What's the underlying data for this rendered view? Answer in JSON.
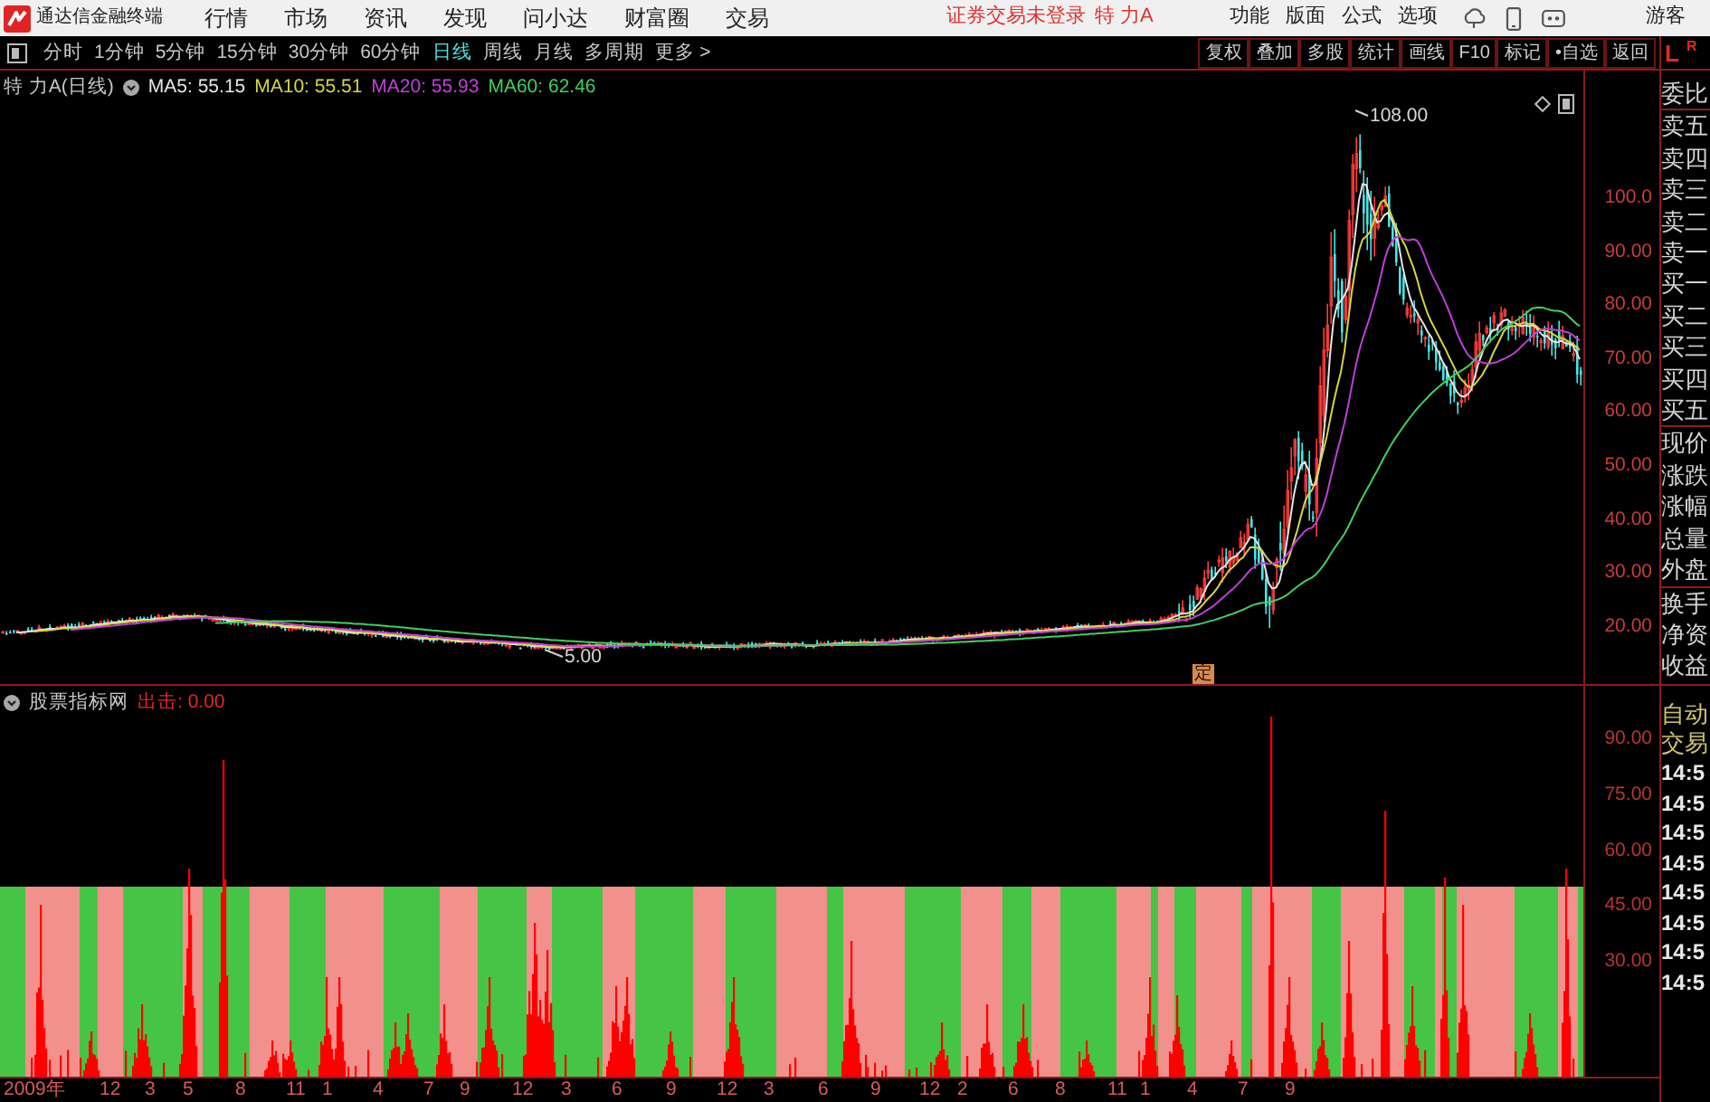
{
  "title_bar": {
    "app_name": "通达信金融终端",
    "menu": [
      "行情",
      "市场",
      "资讯",
      "发现",
      "问小达",
      "财富圈",
      "交易"
    ],
    "login_status": "证券交易未登录",
    "stock_name": "特 力A",
    "tools": [
      "功能",
      "版面",
      "公式",
      "选项"
    ],
    "user": "游客"
  },
  "toolbar": {
    "periods": [
      {
        "label": "分时",
        "selected": false
      },
      {
        "label": "1分钟",
        "selected": false
      },
      {
        "label": "5分钟",
        "selected": false
      },
      {
        "label": "15分钟",
        "selected": false
      },
      {
        "label": "30分钟",
        "selected": false
      },
      {
        "label": "60分钟",
        "selected": false
      },
      {
        "label": "日线",
        "selected": true
      },
      {
        "label": "周线",
        "selected": false
      },
      {
        "label": "月线",
        "selected": false
      },
      {
        "label": "多周期",
        "selected": false
      }
    ],
    "more": "更多 >",
    "actions": [
      "复权",
      "叠加",
      "多股",
      "统计",
      "画线",
      "F10",
      "标记",
      "•自选",
      "返回"
    ]
  },
  "side_header": {
    "left": "L",
    "right": "R"
  },
  "chart": {
    "title": "特 力A(日线)",
    "moving_averages": [
      {
        "label": "MA5: 55.15",
        "color": "#e6e6e6"
      },
      {
        "label": "MA10: 55.51",
        "color": "#d6d640"
      },
      {
        "label": "MA20: 55.93",
        "color": "#c040d8"
      },
      {
        "label": "MA60: 62.46",
        "color": "#40d060"
      }
    ],
    "high_label": "108.00",
    "low_label": "5.00",
    "signal_badge": "定",
    "price_axis": [
      "100.0",
      "90.00",
      "80.00",
      "70.00",
      "60.00",
      "50.00",
      "40.00",
      "30.00",
      "20.00"
    ]
  },
  "quote_panel": {
    "groups": [
      [
        "委比"
      ],
      [
        "卖五",
        "卖四",
        "卖三",
        "卖二",
        "卖一",
        "买一",
        "买二",
        "买三",
        "买四",
        "买五"
      ],
      [
        "现价",
        "涨跌",
        "涨幅",
        "总量",
        "外盘"
      ],
      [
        "换手",
        "净资",
        "收益"
      ]
    ]
  },
  "indicator": {
    "name": "股票指标网",
    "signal_label": "出击: 0.00",
    "axis": [
      "90.00",
      "75.00",
      "60.00",
      "45.00",
      "30.00"
    ]
  },
  "trade_panel": {
    "title": "自动交易",
    "times": [
      "14:5",
      "14:5",
      "14:5",
      "14:5",
      "14:5",
      "14:5",
      "14:5",
      "14:5"
    ]
  },
  "date_axis": [
    "2009年",
    "12",
    "3",
    "5",
    "8",
    "11",
    "1",
    "4",
    "7",
    "9",
    "12",
    "3",
    "6",
    "9",
    "12",
    "3",
    "6",
    "9",
    "12",
    "2",
    "6",
    "8",
    "11",
    "1",
    "4",
    "7",
    "9"
  ]
}
